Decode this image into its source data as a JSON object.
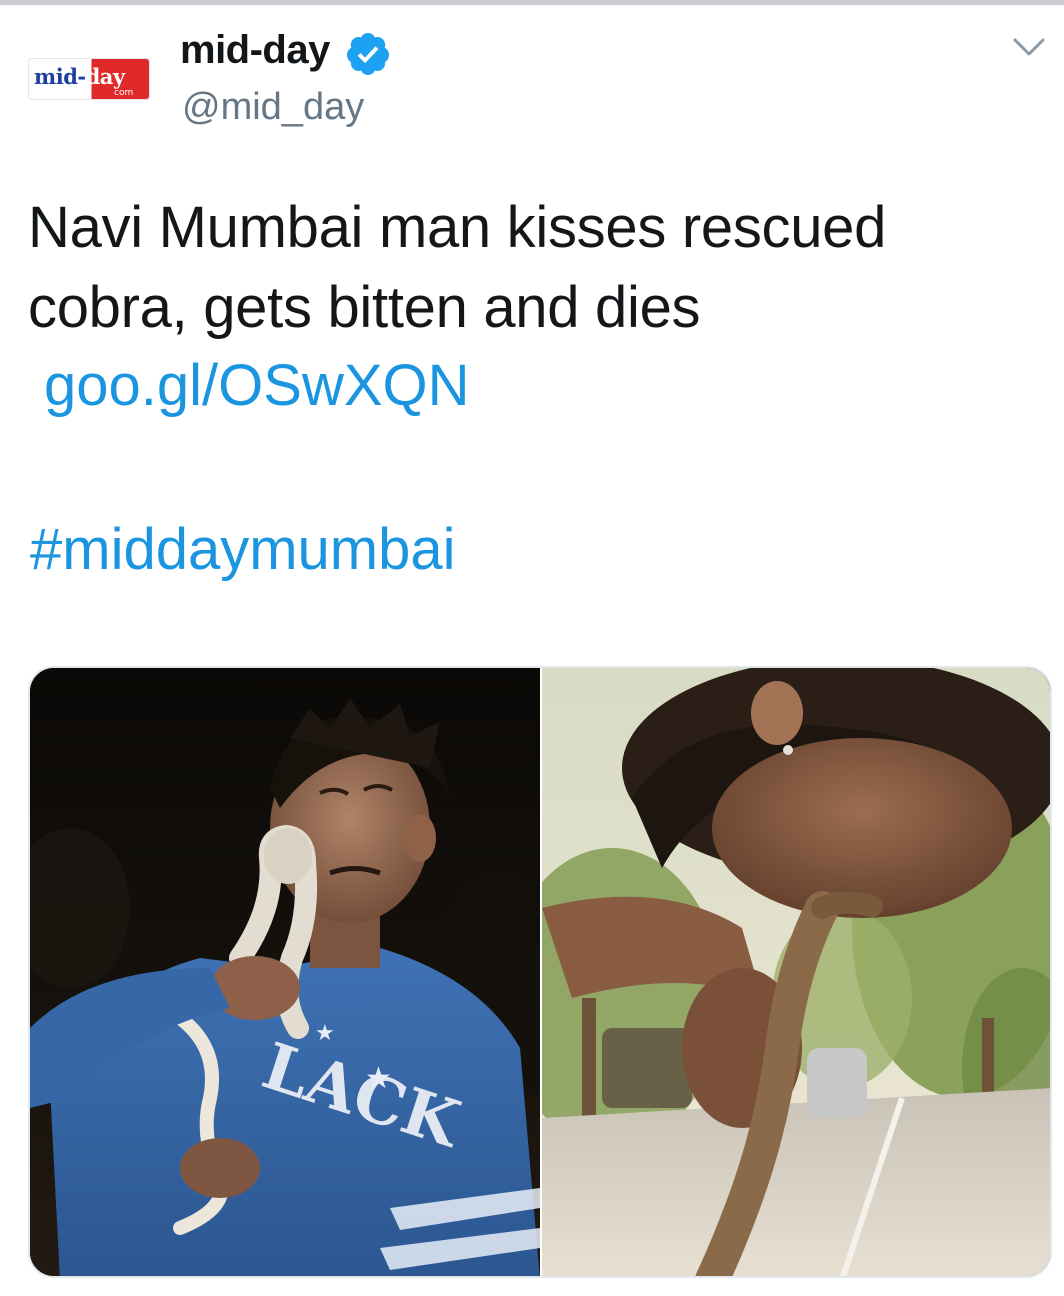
{
  "tweet": {
    "avatar": {
      "logo_text_main": "mid-",
      "logo_text_accent": "day",
      "logo_text_sub": "com",
      "colors": {
        "blue": "#1f3fa0",
        "red": "#e02a2a"
      }
    },
    "display_name": "mid-day",
    "verified": true,
    "handle": "@mid_day",
    "text": "Navi Mumbai man kisses rescued cobra, gets bitten and dies",
    "link": "goo.gl/OSwXQN",
    "hashtag": "#middaymumbai",
    "menu_icon": "chevron-down-icon",
    "colors": {
      "link": "#1b95e0",
      "verified": "#1da1f2",
      "handle": "#657786",
      "text": "#14171a"
    },
    "media": {
      "count": 2,
      "left_photo": "man kissing cobra at night, blue sweatshirt",
      "right_photo": "man kissing cobra outdoors by road with trees"
    }
  }
}
